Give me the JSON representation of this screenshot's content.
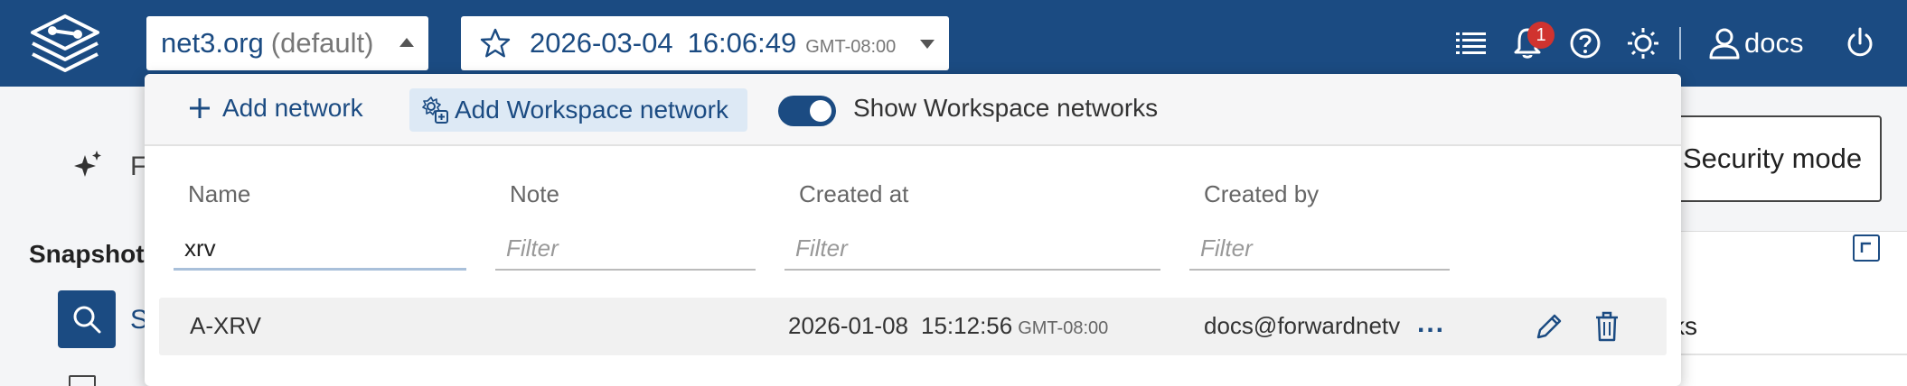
{
  "header": {
    "network_name": "net3.org",
    "network_suffix": "(default)",
    "snapshot_date": "2026-03-04",
    "snapshot_time": "16:06:49",
    "snapshot_tz": "GMT-08:00",
    "notification_count": "1",
    "username": "docs"
  },
  "background": {
    "partial_text_f": "F",
    "snapshot_heading": "Snapshot",
    "partial_text_s": "S",
    "security_mode_button": "Security mode",
    "partial_text_ks": "ks"
  },
  "dropdown": {
    "add_network_label": "Add network",
    "add_workspace_network_label": "Add Workspace network",
    "show_workspace_networks_label": "Show Workspace networks",
    "show_workspace_networks_on": true,
    "columns": [
      "Name",
      "Note",
      "Created at",
      "Created by"
    ],
    "filters": {
      "name_value": "xrv",
      "note_placeholder": "Filter",
      "created_at_placeholder": "Filter",
      "created_by_placeholder": "Filter"
    },
    "rows": [
      {
        "name": "A-XRV",
        "note": "",
        "created_date": "2026-01-08",
        "created_time": "15:12:56",
        "created_tz": "GMT-08:00",
        "created_by": "docs@forwardnetv",
        "more_label": "..."
      }
    ]
  },
  "colors": {
    "primary": "#1b4b82",
    "badge": "#d0332f",
    "workspace_button_bg": "#dde9f5"
  }
}
